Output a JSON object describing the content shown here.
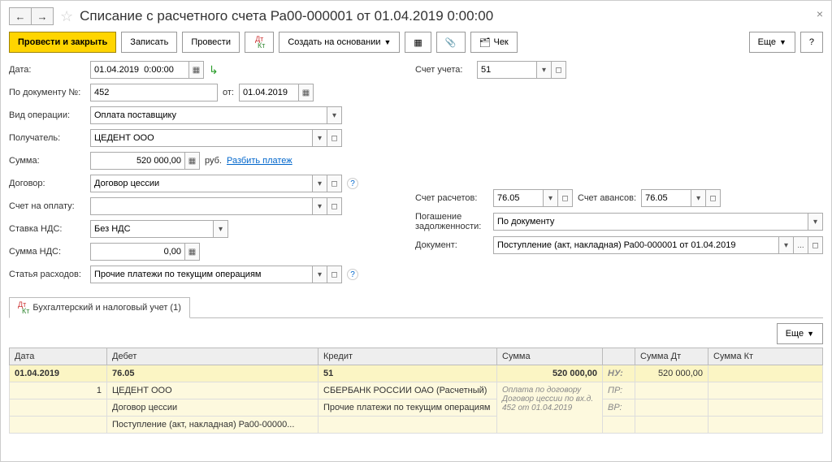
{
  "window": {
    "title": "Списание с расчетного счета Ра00-000001 от 01.04.2019 0:00:00"
  },
  "toolbar": {
    "post_close": "Провести и закрыть",
    "save": "Записать",
    "post": "Провести",
    "create_based": "Создать на основании",
    "check": "Чек",
    "more": "Еще",
    "help": "?"
  },
  "fields": {
    "date_label": "Дата:",
    "date_value": "01.04.2019  0:00:00",
    "docnum_label": "По документу №:",
    "docnum_value": "452",
    "docnum_from_label": "от:",
    "docnum_from_value": "01.04.2019",
    "optype_label": "Вид операции:",
    "optype_value": "Оплата поставщику",
    "receiver_label": "Получатель:",
    "receiver_value": "ЦЕДЕНТ ООО",
    "sum_label": "Сумма:",
    "sum_value": "520 000,00",
    "sum_currency": "руб.",
    "split_payment": "Разбить платеж",
    "contract_label": "Договор:",
    "contract_value": "Договор цессии",
    "invoice_label": "Счет на оплату:",
    "invoice_value": "",
    "vat_rate_label": "Ставка НДС:",
    "vat_rate_value": "Без НДС",
    "vat_sum_label": "Сумма НДС:",
    "vat_sum_value": "0,00",
    "expense_label": "Статья расходов:",
    "expense_value": "Прочие платежи по текущим операциям",
    "account_label": "Счет учета:",
    "account_value": "51",
    "settle_acc_label": "Счет расчетов:",
    "settle_acc_value": "76.05",
    "advance_acc_label": "Счет авансов:",
    "advance_acc_value": "76.05",
    "debt_label": "Погашение задолженности:",
    "debt_value": "По документу",
    "document_label": "Документ:",
    "document_value": "Поступление (акт, накладная) Ра00-000001 от 01.04.2019"
  },
  "tab": {
    "label": "Бухгалтерский и налоговый учет (1)",
    "more": "Еще"
  },
  "grid": {
    "headers": {
      "date": "Дата",
      "debit": "Дебет",
      "credit": "Кредит",
      "sum": "Сумма",
      "sum_dt": "Сумма Дт",
      "sum_kt": "Сумма Кт"
    },
    "row": {
      "date": "01.04.2019",
      "num": "1",
      "debit_acc": "76.05",
      "credit_acc": "51",
      "sum": "520 000,00",
      "nu_label": "НУ:",
      "pr_label": "ПР:",
      "vr_label": "ВР:",
      "sum_dt": "520 000,00",
      "debit_sub1": "ЦЕДЕНТ ООО",
      "debit_sub2": "Договор цессии",
      "debit_sub3": "Поступление (акт, накладная) Ра00-00000...",
      "credit_sub1": "СБЕРБАНК РОССИИ ОАО (Расчетный)",
      "credit_sub2": "Прочие платежи по текущим операциям",
      "sum_note": "Оплата по договору Договор цессии по вх.д. 452 от 01.04.2019"
    }
  }
}
